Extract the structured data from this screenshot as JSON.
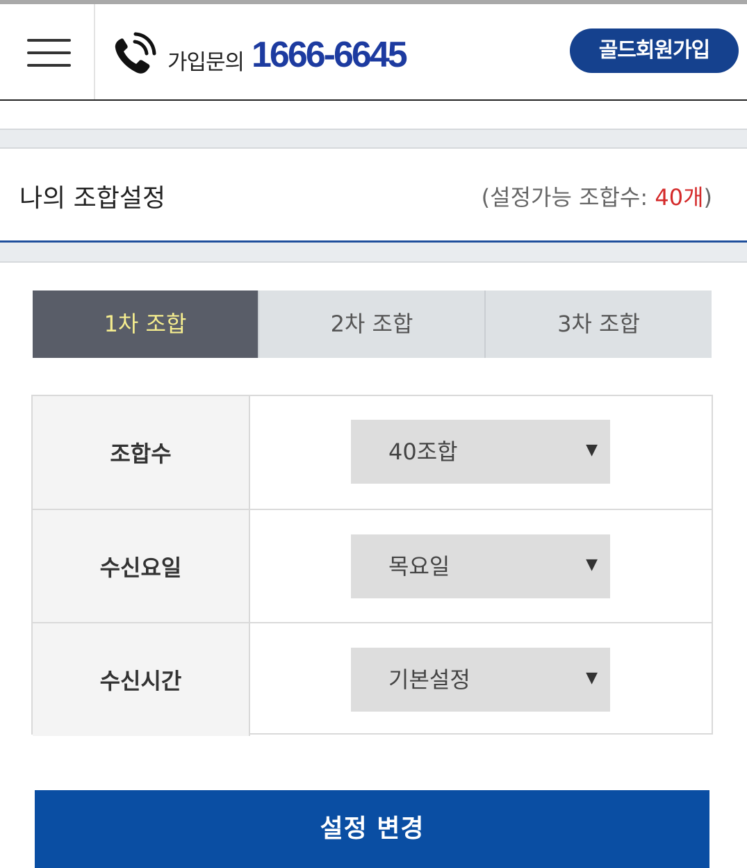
{
  "header": {
    "menu_icon": "hamburger-menu-icon",
    "phone_icon": "phone-ringing-icon",
    "inquiry_label": "가입문의",
    "inquiry_number": "1666-6645",
    "join_button": "골드회원가입"
  },
  "section": {
    "title": "나의 조합설정",
    "available_open": "(설정가능 조합수: ",
    "available_count": "40개",
    "available_close": ")"
  },
  "tabs": [
    {
      "label": "1차 조합",
      "active": true
    },
    {
      "label": "2차 조합",
      "active": false
    },
    {
      "label": "3차 조합",
      "active": false
    }
  ],
  "settings": [
    {
      "label": "조합수",
      "value": "40조합"
    },
    {
      "label": "수신요일",
      "value": "목요일"
    },
    {
      "label": "수신시간",
      "value": "기본설정"
    }
  ],
  "dropdown_arrow": "▼",
  "submit_label": "설정 변경",
  "colors": {
    "brand_blue": "#15418e",
    "number_blue": "#1d3ba0",
    "active_tab_bg": "#595d68",
    "active_tab_text": "#f5ed8f",
    "count_red": "#d42a2a",
    "submit_blue": "#0a4ea3"
  }
}
